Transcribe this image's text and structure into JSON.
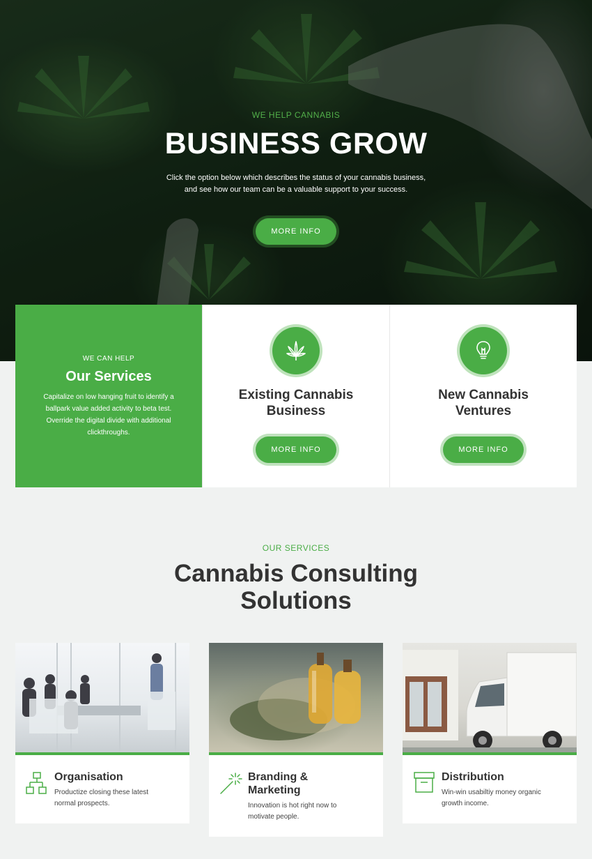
{
  "hero": {
    "kicker": "WE HELP CANNABIS",
    "title": "BUSINESS GROW",
    "text_line1": "Click the option below which describes the status of your cannabis business,",
    "text_line2": "and see how our team can be a valuable support to your success.",
    "button": "MORE INFO"
  },
  "services_card": {
    "kicker": "WE CAN HELP",
    "title": "Our Services",
    "desc_lines": [
      "Capitalize on low hanging fruit to identify a",
      "ballpark value added activity to beta test.",
      "Override the digital divide with additional",
      "clickthroughs."
    ]
  },
  "option_cards": [
    {
      "icon": "cannabis-leaf-icon",
      "title_line1": "Existing Cannabis",
      "title_line2": "Business",
      "button": "MORE INFO"
    },
    {
      "icon": "lightbulb-icon",
      "title_line1": "New Cannabis",
      "title_line2": "Ventures",
      "button": "MORE INFO"
    }
  ],
  "section": {
    "kicker": "OUR SERVICES",
    "title_line1": "Cannabis Consulting",
    "title_line2": "Solutions"
  },
  "solutions": [
    {
      "icon": "org-chart-icon",
      "title_line1": "Organisation",
      "title_line2": "",
      "desc_line1": "Productize closing these latest",
      "desc_line2": "normal prospects."
    },
    {
      "icon": "magic-wand-icon",
      "title_line1": "Branding &",
      "title_line2": "Marketing",
      "desc_line1": "Innovation is hot right now to",
      "desc_line2": "motivate people."
    },
    {
      "icon": "archive-box-icon",
      "title_line1": "Distribution",
      "title_line2": "",
      "desc_line1": "Win-win usabiltiy money organic",
      "desc_line2": "growth income."
    }
  ],
  "colors": {
    "accent": "#4aad46",
    "accent_light": "#bfe3bc",
    "heading": "#333333",
    "page_bg": "#f0f2f1"
  }
}
